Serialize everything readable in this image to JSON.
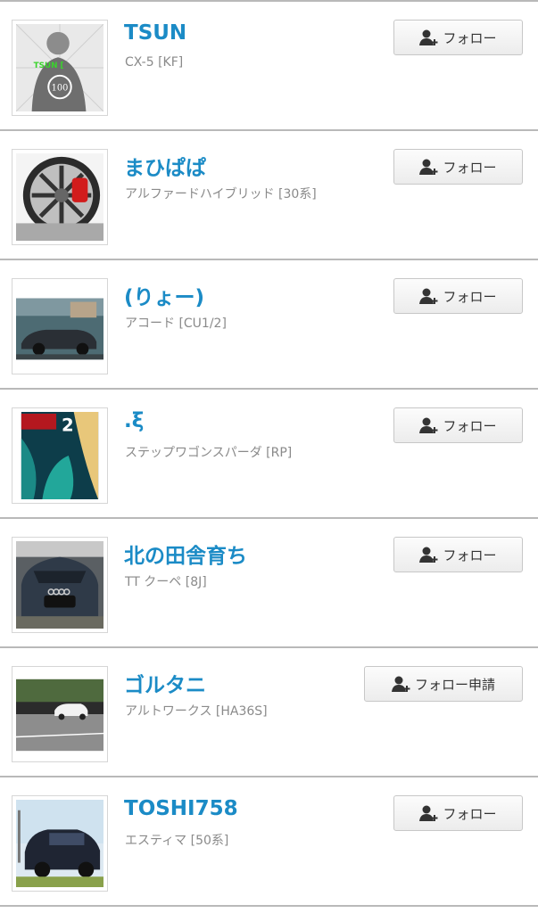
{
  "users": [
    {
      "name": "TSUN",
      "car": "CX-5 [KF]",
      "button": "フォロー",
      "thumb_text": "TSUN [",
      "thumb_badge": "100"
    },
    {
      "name": "まひぱぱ",
      "car": "アルファードハイブリッド [30系]",
      "button": "フォロー"
    },
    {
      "name": "(りょー)",
      "car": "アコード [CU1/2]",
      "button": "フォロー"
    },
    {
      "name": ".ξ",
      "car": "ステップワゴンスパーダ [RP]",
      "button": "フォロー",
      "thumb_text": "2"
    },
    {
      "name": "北の田舎育ち",
      "car": "TT クーペ [8J]",
      "button": "フォロー"
    },
    {
      "name": "ゴルタニ",
      "car": "アルトワークス [HA36S]",
      "button": "フォロー申請"
    },
    {
      "name": "TOSHI758",
      "car": "エスティマ [50系]",
      "button": "フォロー"
    }
  ],
  "colors": {
    "name": "#1b8bc6",
    "subtext": "#8a8a8a",
    "divider": "#b9b9b9"
  }
}
